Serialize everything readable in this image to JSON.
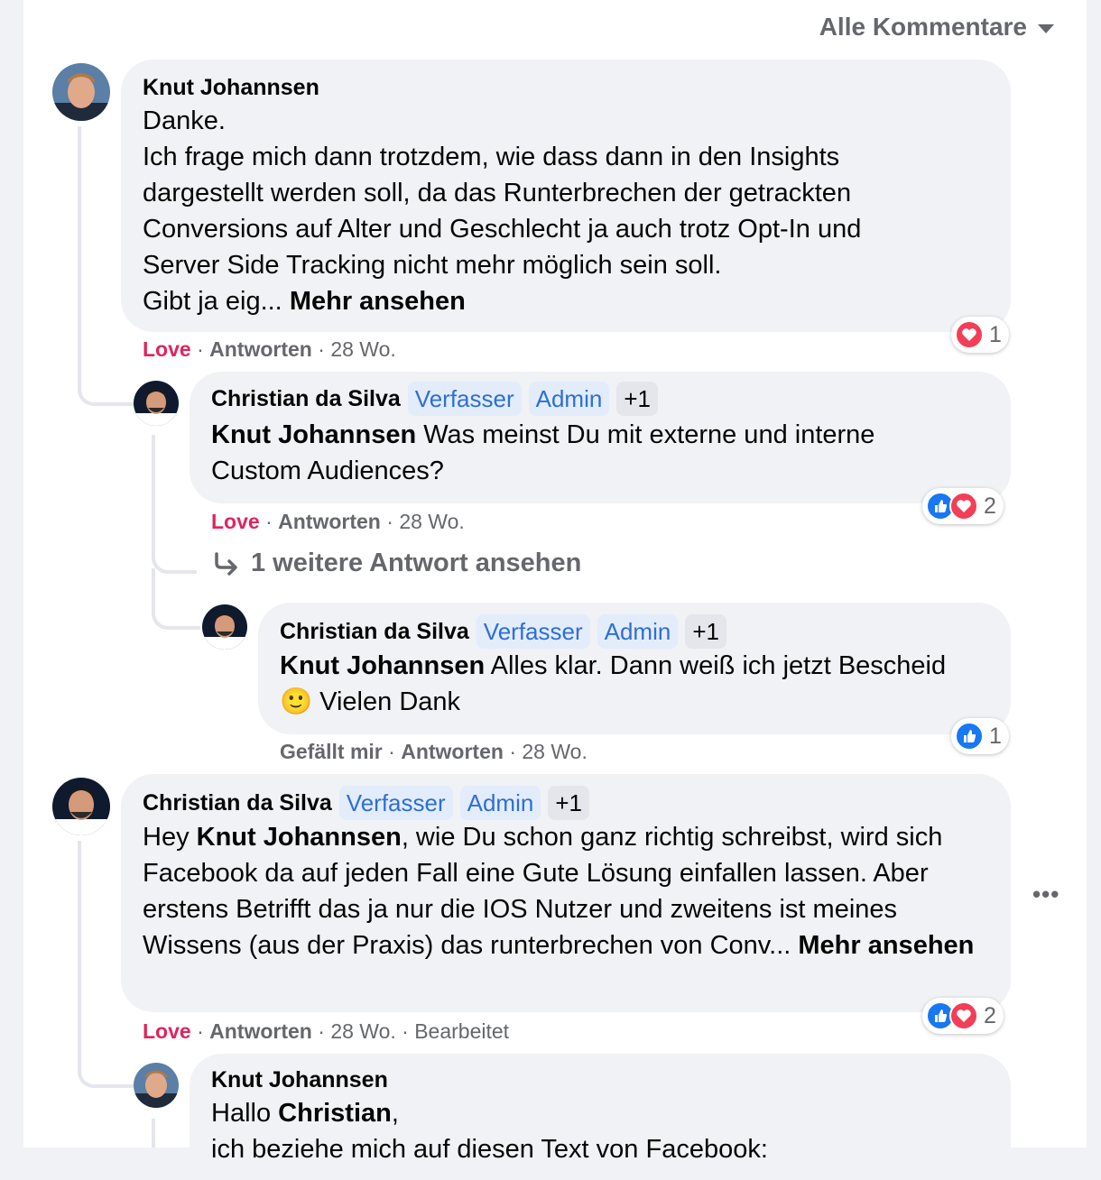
{
  "sort_label": "Alle Kommentare",
  "comments": [
    {
      "author": "Knut Johannsen",
      "lines": [
        "Danke.",
        "Ich frage mich dann trotzdem, wie dass dann in den Insights",
        "dargestellt werden soll, da das Runterbrechen der getrackten",
        "Conversions auf Alter und Geschlecht ja auch trotz Opt-In und",
        "Server Side Tracking nicht mehr möglich sein soll."
      ],
      "truncated_text": "Gibt ja eig... ",
      "see_more": "Mehr ansehen",
      "reaction_label": "Love",
      "reply_label": "Antworten",
      "time": "28 Wo.",
      "reaction_count": "1"
    },
    {
      "author": "Christian da Silva",
      "badges": [
        "Verfasser",
        "Admin",
        "+1"
      ],
      "mention": "Knut Johannsen",
      "text_after_mention": " Was meinst Du mit externe und interne",
      "text_line2": "Custom Audiences?",
      "reaction_label": "Love",
      "reply_label": "Antworten",
      "time": "28 Wo.",
      "reaction_count": "2"
    },
    {
      "view_more_replies": "1 weitere Antwort ansehen"
    },
    {
      "author": "Christian da Silva",
      "badges": [
        "Verfasser",
        "Admin",
        "+1"
      ],
      "mention": "Knut Johannsen",
      "text_after_mention": " Alles klar. Dann weiß ich jetzt Bescheid",
      "emoji": "🙂",
      "text_line2": " Vielen Dank",
      "reaction_label": "Gefällt mir",
      "reply_label": "Antworten",
      "time": "28 Wo.",
      "reaction_count": "1"
    },
    {
      "author": "Christian da Silva",
      "badges": [
        "Verfasser",
        "Admin",
        "+1"
      ],
      "prefix": "Hey ",
      "mention": "Knut Johannsen",
      "text_after_mention": ", wie Du schon ganz richtig schreibst, wird sich",
      "lines": [
        "Facebook da auf jeden Fall eine Gute Lösung einfallen lassen. Aber",
        "erstens Betrifft das ja nur die IOS Nutzer und zweitens ist meines"
      ],
      "truncated_text": "Wissens (aus der Praxis) das runterbrechen von Conv... ",
      "see_more": "Mehr ansehen",
      "reaction_label": "Love",
      "reply_label": "Antworten",
      "time": "28 Wo.",
      "edited": "Bearbeitet",
      "reaction_count": "2"
    },
    {
      "author": "Knut Johannsen",
      "greeting": "Hallo ",
      "mention": "Christian",
      "greeting_end": ",",
      "line2": "ich beziehe mich auf diesen Text von Facebook:"
    }
  ],
  "colors": {
    "love": "#e0245e",
    "link_blue": "#1877f2",
    "meta_gray": "#65676b",
    "bubble": "#f0f2f5"
  }
}
